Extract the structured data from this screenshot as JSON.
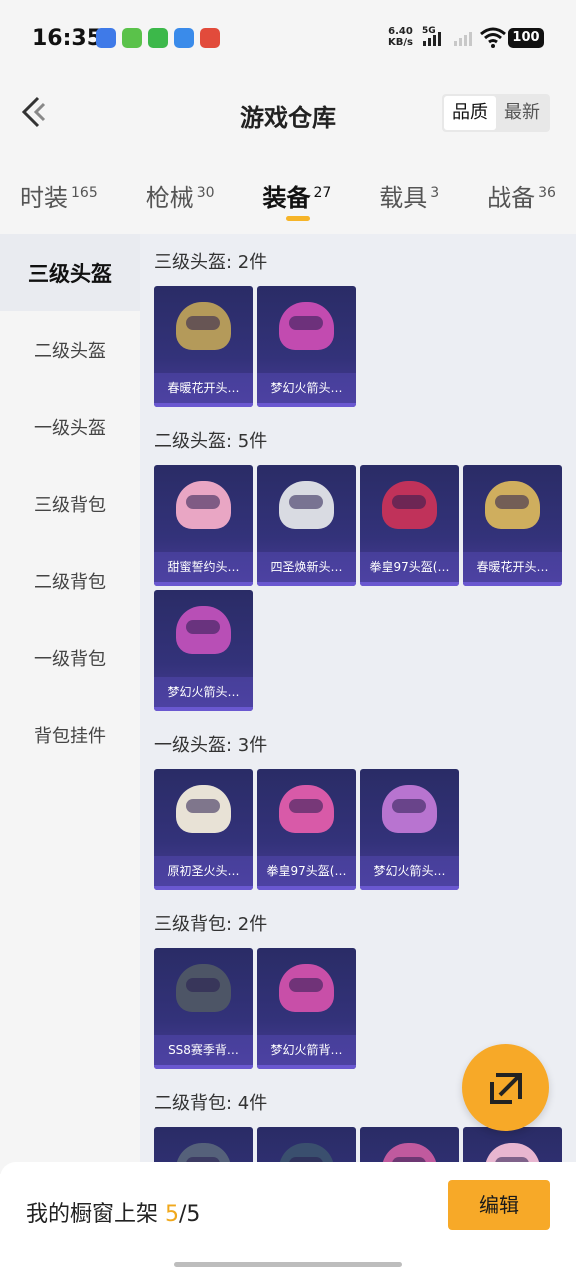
{
  "status_bar": {
    "time": "16:35",
    "net_speed_value": "6.40",
    "net_speed_unit": "KB/s",
    "network": "5G",
    "battery": "100"
  },
  "header": {
    "title": "游戏仓库",
    "sort_options": [
      "品质",
      "最新"
    ],
    "sort_active": "品质"
  },
  "tabs": [
    {
      "label": "时装",
      "count": "165"
    },
    {
      "label": "枪械",
      "count": "30"
    },
    {
      "label": "装备",
      "count": "27",
      "active": true
    },
    {
      "label": "载具",
      "count": "3"
    },
    {
      "label": "战备",
      "count": "36"
    }
  ],
  "sidebar": {
    "items": [
      "三级头盔",
      "二级头盔",
      "一级头盔",
      "三级背包",
      "二级背包",
      "一级背包",
      "背包挂件"
    ],
    "active": "三级头盔"
  },
  "sections": [
    {
      "title": "三级头盔: 2件",
      "items": [
        {
          "name": "春暖花开头…",
          "icon": "helmet-icon",
          "color": "#b49a5a"
        },
        {
          "name": "梦幻火箭头…",
          "icon": "helmet-icon",
          "color": "#c24bb0"
        }
      ]
    },
    {
      "title": "二级头盔: 5件",
      "items": [
        {
          "name": "甜蜜誓约头…",
          "icon": "helmet-icon",
          "color": "#e9a6c4"
        },
        {
          "name": "四圣焕新头…",
          "icon": "helmet-icon",
          "color": "#d9dbe2"
        },
        {
          "name": "拳皇97头盔(…",
          "icon": "helmet-icon",
          "color": "#c0325a"
        },
        {
          "name": "春暖花开头…",
          "icon": "helmet-icon",
          "color": "#cfae5e"
        },
        {
          "name": "梦幻火箭头…",
          "icon": "helmet-icon",
          "color": "#b84fb6"
        }
      ]
    },
    {
      "title": "一级头盔: 3件",
      "items": [
        {
          "name": "原初圣火头…",
          "icon": "helmet-icon",
          "color": "#e8e2d6"
        },
        {
          "name": "拳皇97头盔(…",
          "icon": "helmet-icon",
          "color": "#d85aa8"
        },
        {
          "name": "梦幻火箭头…",
          "icon": "helmet-icon",
          "color": "#b874d0"
        }
      ]
    },
    {
      "title": "三级背包: 2件",
      "items": [
        {
          "name": "SS8赛季背…",
          "icon": "backpack-icon",
          "color": "#4d5566"
        },
        {
          "name": "梦幻火箭背…",
          "icon": "backpack-icon",
          "color": "#c84fa8"
        }
      ]
    },
    {
      "title": "二级背包: 4件",
      "items": [
        {
          "name": "",
          "icon": "backpack-icon",
          "color": "#55617a"
        },
        {
          "name": "",
          "icon": "backpack-icon",
          "color": "#3a4f6e"
        },
        {
          "name": "",
          "icon": "backpack-icon",
          "color": "#c05a9e"
        },
        {
          "name": "",
          "icon": "backpack-icon",
          "color": "#e8b6d0"
        }
      ]
    }
  ],
  "bottom": {
    "shelf_label": "我的橱窗上架",
    "shelf_current": "5",
    "shelf_total": "/5",
    "edit_label": "编辑"
  },
  "colors": {
    "accent": "#f7a928",
    "card_bg": "#2e2f6e"
  }
}
